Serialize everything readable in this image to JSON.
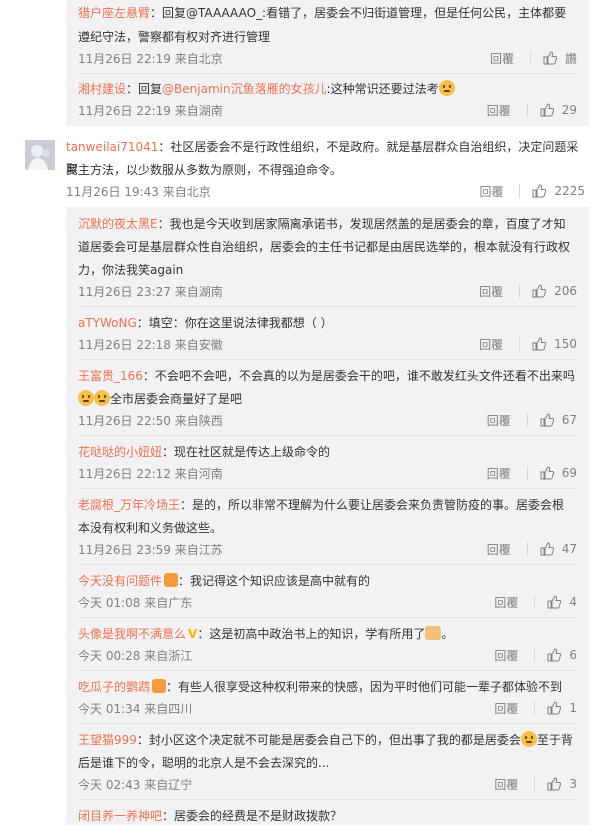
{
  "reply_label": "回覆",
  "c1": {
    "name": "猎户座左悬臂",
    "mention": "@TAAAAAO_",
    "line1": "：回复@TAAAAAO_:看错了，居委会不归街道管理，但是任何公民，主体都要",
    "line2": "遵纪守法，警察都有权对齐进行管理",
    "time": "11月26日 22:19 来自北京",
    "likes": "讚"
  },
  "c2": {
    "name": "湘村建设",
    "line1": "：回复",
    "mention": "@Benjamin沉鱼落雁的女孩儿",
    "line1b": ":这种常识还要过法考",
    "time": "11月26日 22:19 来自湖南",
    "likes": "29"
  },
  "c3": {
    "name": "tanweilai71041",
    "line1": "：社区居委会不是行政性组织，不是政府。就是基层群众自治组织，决定问题采取",
    "line2": "民主方法，以少数服从多数为原则，不得强迫命令。",
    "time": "11月26日 19:43 来自北京",
    "likes": "2225"
  },
  "c4": {
    "name": "沉默的夜太黑E",
    "line1": "：我也是今天收到居家隔离承诺书，发现居然盖的是居委会的章，百度了才知",
    "line2": "道居委会可是基层群众性自治组织，居委会的主任书记都是由居民选举的，根本就没有行政权",
    "line3": "力，你法我笑again",
    "time": "11月26日 23:27 来自湖南",
    "likes": "206"
  },
  "c5": {
    "name": "aTYWoNG",
    "line1": "：填空：你在这里说法律我都想（ ）",
    "time": "11月26日 22:18 来自安徽",
    "likes": "150"
  },
  "c6": {
    "name": "王富贵_166",
    "line1": "：不会吧不会吧，不会真的以为是居委会干的吧，谁不敢发红头文件还看不出来吗",
    "line2": "全市居委会商量好了是吧",
    "time": "11月26日 22:50 来自陕西",
    "likes": "67"
  },
  "c7": {
    "name": "花哒哒的小妞妞",
    "line1": "：现在社区就是传达上级命令的",
    "time": "11月26日 22:12 来自河南",
    "likes": "69"
  },
  "c8": {
    "name": "老腐根_万年冷场王",
    "line1": "：是的，所以非常不理解为什么要让居委会来负责管防疫的事。居委会根",
    "line2": "本没有权利和义务做这些。",
    "time": "11月26日 23:59 来自江苏",
    "likes": "47"
  },
  "c9": {
    "name": "今天没有问题件",
    "line1": "：我记得这个知识应该是高中就有的",
    "time": "今天 01:08 来自广东",
    "likes": "4"
  },
  "c10": {
    "name": "头像是我啊不满意么",
    "line1": "：这是初高中政治书上的知识，学有所用了",
    "line1end": "。",
    "time": "今天 00:28 来自浙江",
    "likes": "6"
  },
  "c11": {
    "name": "吃瓜子的鹦鹉",
    "line1": "：有些人很享受这种权利带来的快感，因为平时他们可能一辈子都体验不到",
    "time": "今天 01:34 来自四川",
    "likes": "1"
  },
  "c12": {
    "name": "王望猫999",
    "line1": "：封小区这个决定就不可能是居委会自己下的，但出事了我的都是居委会",
    "line1end": "至于背",
    "line2": "后是谁下的令，聪明的北京人是不会去深究的...",
    "time": "今天 02:43 来自辽宁",
    "likes": "3"
  },
  "c13": {
    "name": "闭目养一养神吧",
    "line1": "：居委会的经费是不是财政拨款？"
  }
}
